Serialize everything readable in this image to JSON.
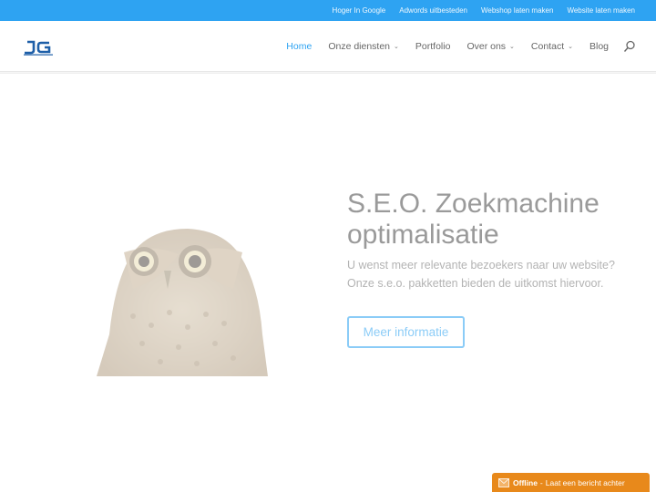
{
  "topbar": {
    "links": [
      "Hoger In Google",
      "Adwords uitbesteden",
      "Webshop laten maken",
      "Website laten maken"
    ]
  },
  "nav": {
    "items": [
      {
        "label": "Home",
        "active": true,
        "dropdown": false
      },
      {
        "label": "Onze diensten",
        "active": false,
        "dropdown": true
      },
      {
        "label": "Portfolio",
        "active": false,
        "dropdown": false
      },
      {
        "label": "Over ons",
        "active": false,
        "dropdown": true
      },
      {
        "label": "Contact",
        "active": false,
        "dropdown": true
      },
      {
        "label": "Blog",
        "active": false,
        "dropdown": false
      }
    ],
    "search_icon": "search-icon",
    "caret": "⌄"
  },
  "hero": {
    "title": "S.E.O. Zoekmachine optimalisatie",
    "subtitle": "U wenst meer relevante bezoekers naar uw website? Onze s.e.o. pakketten bieden de uitkomst hiervoor.",
    "button_label": "Meer informatie"
  },
  "chat": {
    "status": "Offline",
    "separator": "-",
    "message": "Laat een bericht achter"
  },
  "colors": {
    "accent": "#2ea3f2",
    "chat": "#e8891b"
  }
}
